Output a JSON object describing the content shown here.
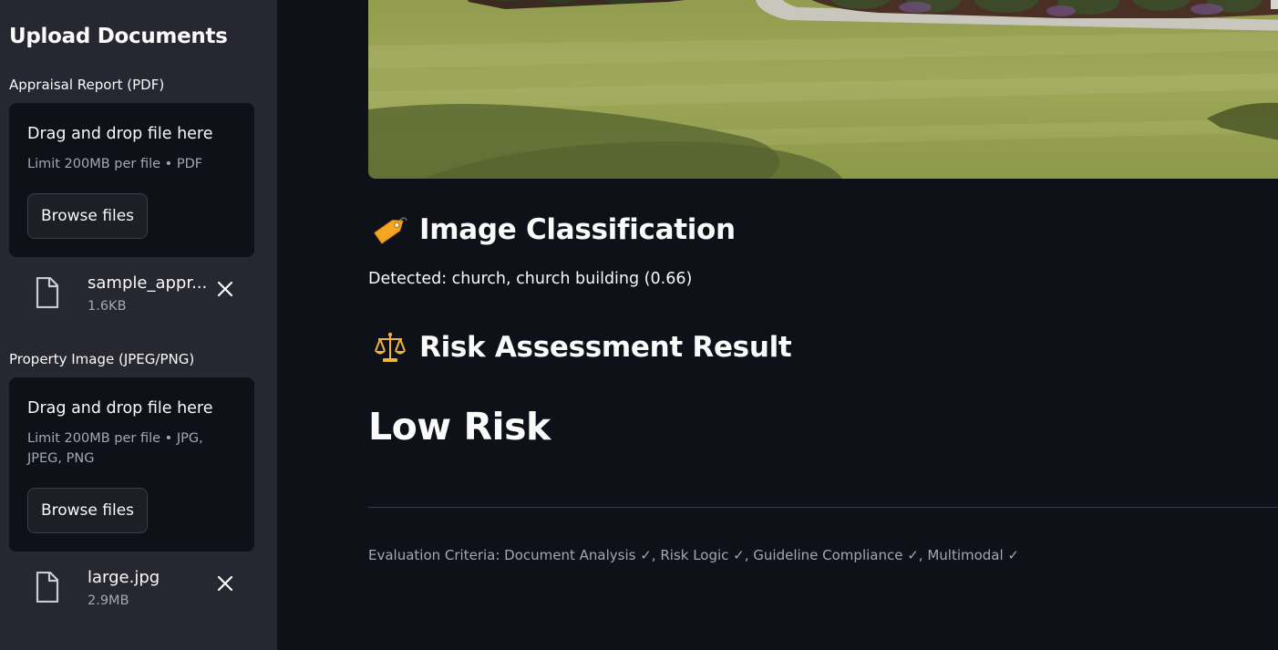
{
  "sidebar": {
    "title": "Upload Documents",
    "uploaders": [
      {
        "label": "Appraisal Report (PDF)",
        "drop_title": "Drag and drop file here",
        "limit": "Limit 200MB per file • PDF",
        "browse_label": "Browse files",
        "file": {
          "name": "sample_appr...",
          "size": "1.6KB"
        }
      },
      {
        "label": "Property Image (JPEG/PNG)",
        "drop_title": "Drag and drop file here",
        "limit": "Limit 200MB per file • JPG, JPEG, PNG",
        "browse_label": "Browse files",
        "file": {
          "name": "large.jpg",
          "size": "2.9MB"
        }
      }
    ]
  },
  "main": {
    "classification": {
      "heading": "Image Classification",
      "icon": "tag-icon",
      "detected": "Detected: church, church building (0.66)"
    },
    "risk": {
      "heading": "Risk Assessment Result",
      "icon": "scales-icon",
      "level": "Low Risk"
    },
    "criteria": "Evaluation Criteria: Document Analysis ✓, Risk Logic ✓, Guideline Compliance ✓, Multimodal ✓"
  },
  "colors": {
    "background": "#0e1117",
    "sidebar": "#262730",
    "text": "#fafafa",
    "muted": "#a3a8b4"
  }
}
